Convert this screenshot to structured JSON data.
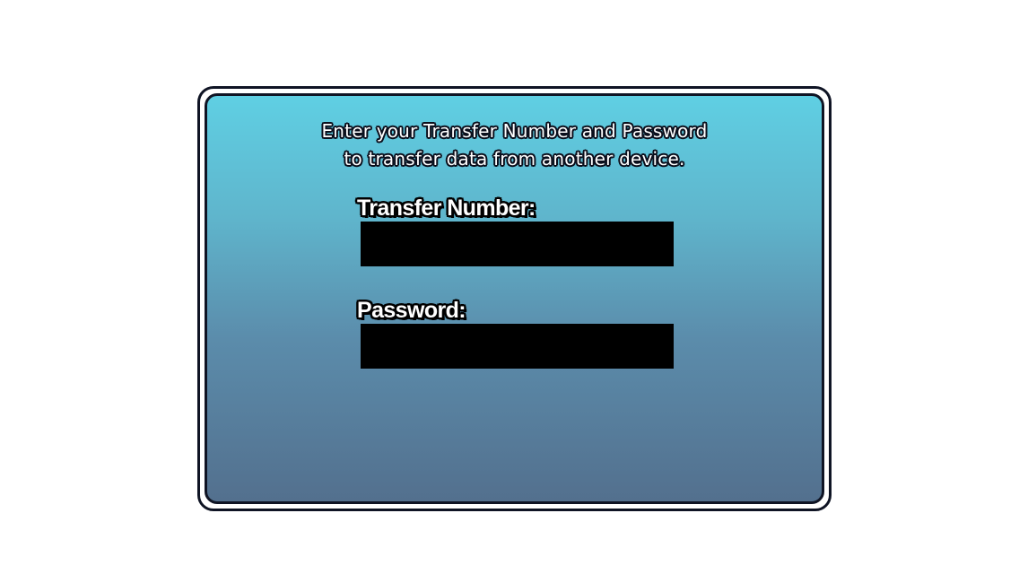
{
  "instructions": {
    "line1": "Enter your Transfer Number and Password",
    "line2": "to transfer data from another device."
  },
  "transfer_number": {
    "label": "Transfer Number:",
    "value": ""
  },
  "password": {
    "label": "Password:",
    "value": ""
  },
  "colors": {
    "panel_top": "#5fcfe3",
    "panel_bottom": "#53708e",
    "border": "#0f1424",
    "input_background": "#000000",
    "text": "#ffffff"
  }
}
